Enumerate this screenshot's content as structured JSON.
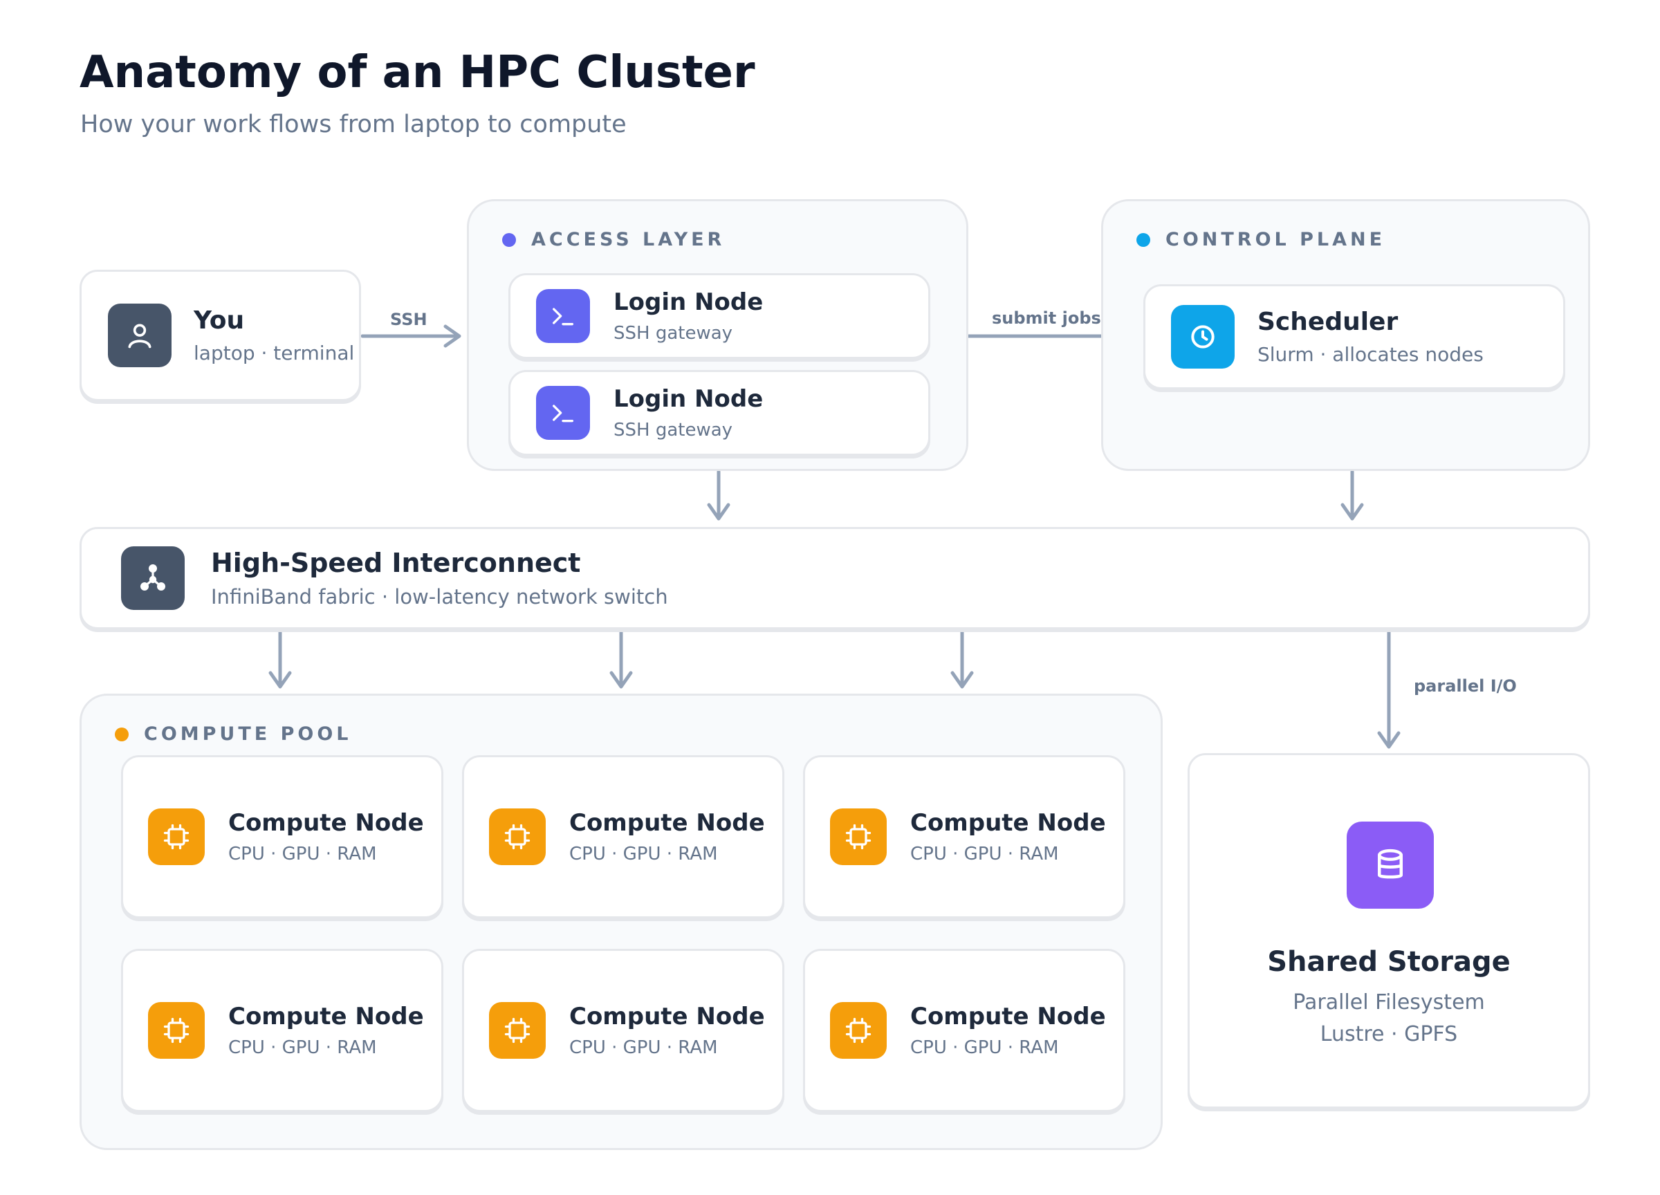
{
  "header": {
    "title": "Anatomy of an HPC Cluster",
    "subtitle": "How your work flows from laptop to compute"
  },
  "colors": {
    "access": "#6366f1",
    "control": "#0ea5e9",
    "compute": "#f59e0b",
    "storage": "#8b5cf6",
    "neutral_icon": "#475569",
    "arrow": "#94a3b8"
  },
  "user": {
    "title": "You",
    "subtitle": "laptop · terminal",
    "icon": "user-icon"
  },
  "access_layer": {
    "label": "ACCESS LAYER",
    "nodes": [
      {
        "title": "Login Node",
        "subtitle": "SSH gateway",
        "icon": "terminal-icon"
      },
      {
        "title": "Login Node",
        "subtitle": "SSH gateway",
        "icon": "terminal-icon"
      }
    ]
  },
  "control_plane": {
    "label": "CONTROL PLANE",
    "scheduler": {
      "title": "Scheduler",
      "subtitle": "Slurm · allocates nodes",
      "icon": "clock-icon"
    }
  },
  "interconnect": {
    "title": "High-Speed Interconnect",
    "subtitle": "InfiniBand fabric · low-latency network switch",
    "icon": "network-icon"
  },
  "compute_pool": {
    "label": "COMPUTE POOL",
    "nodes": [
      {
        "title": "Compute Node",
        "subtitle": "CPU · GPU · RAM",
        "icon": "chip-icon"
      },
      {
        "title": "Compute Node",
        "subtitle": "CPU · GPU · RAM",
        "icon": "chip-icon"
      },
      {
        "title": "Compute Node",
        "subtitle": "CPU · GPU · RAM",
        "icon": "chip-icon"
      },
      {
        "title": "Compute Node",
        "subtitle": "CPU · GPU · RAM",
        "icon": "chip-icon"
      },
      {
        "title": "Compute Node",
        "subtitle": "CPU · GPU · RAM",
        "icon": "chip-icon"
      },
      {
        "title": "Compute Node",
        "subtitle": "CPU · GPU · RAM",
        "icon": "chip-icon"
      }
    ]
  },
  "storage": {
    "title": "Shared Storage",
    "line1": "Parallel Filesystem",
    "line2": "Lustre · GPFS",
    "icon": "database-icon"
  },
  "edges": {
    "ssh": "SSH",
    "submit": "submit jobs",
    "io": "parallel I/O"
  }
}
